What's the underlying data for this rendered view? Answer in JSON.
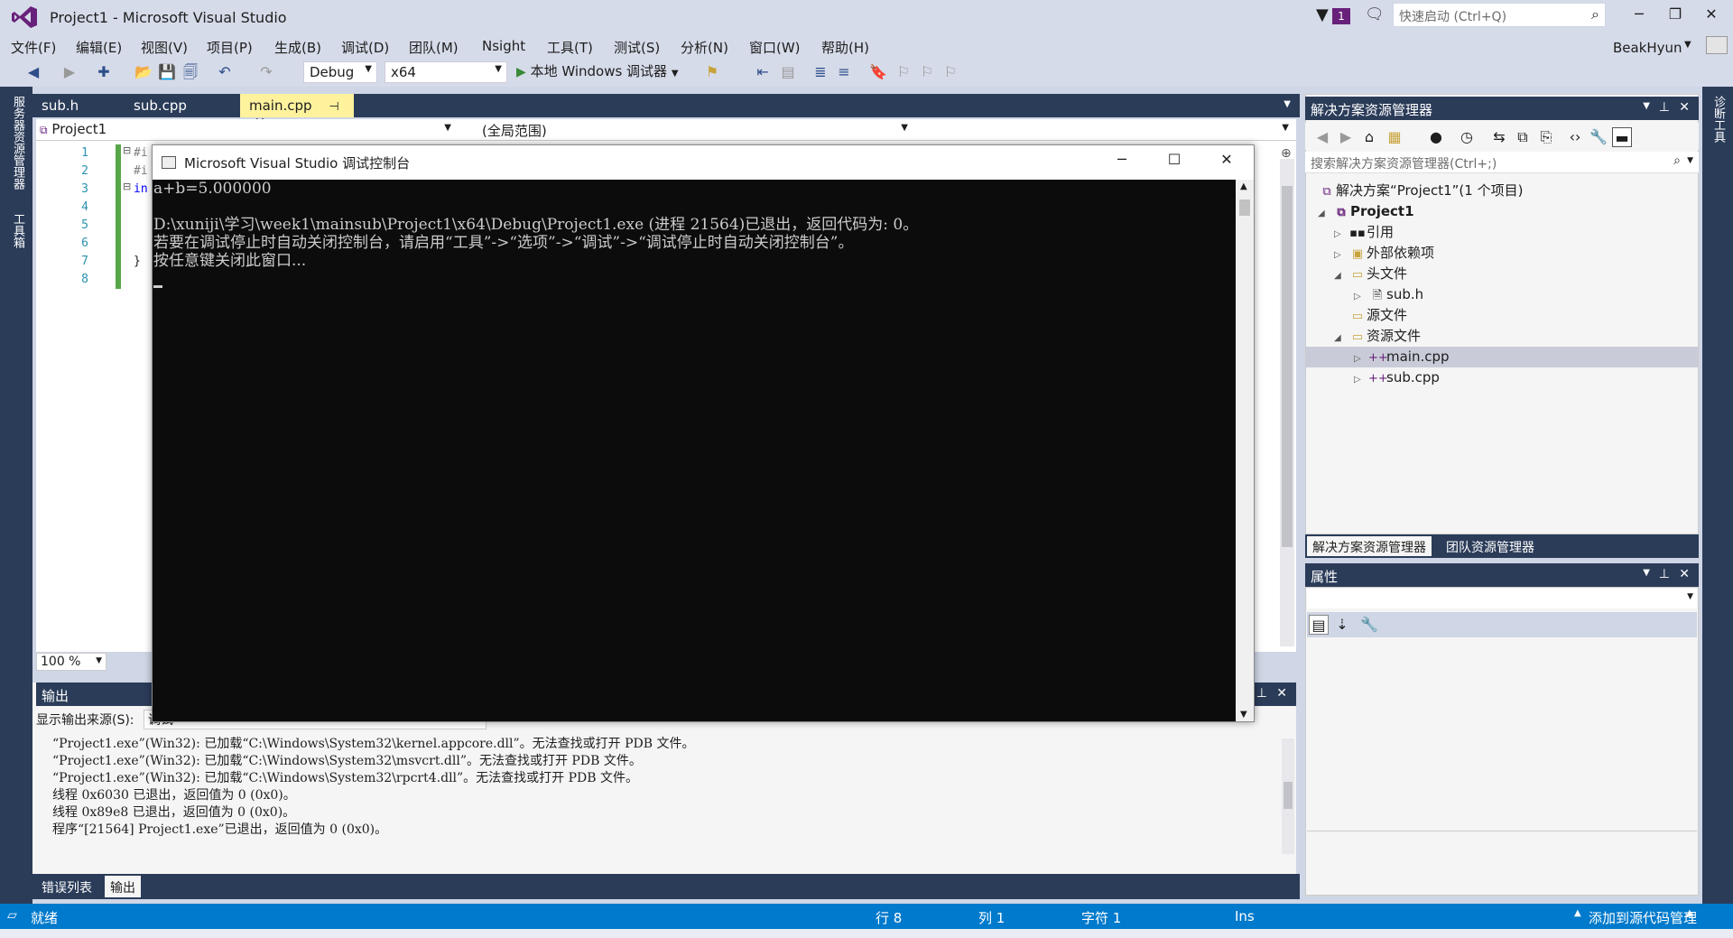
{
  "window": {
    "title": "Project1 - Microsoft Visual Studio",
    "notification_count": "1",
    "quick_launch_placeholder": "快速启动 (Ctrl+Q)",
    "user": "BeakHyun"
  },
  "menu": [
    "文件(F)",
    "编辑(E)",
    "视图(V)",
    "项目(P)",
    "生成(B)",
    "调试(D)",
    "团队(M)",
    "Nsight",
    "工具(T)",
    "测试(S)",
    "分析(N)",
    "窗口(W)",
    "帮助(H)"
  ],
  "toolbar": {
    "config": "Debug",
    "platform": "x64",
    "run_label": "本地 Windows 调试器"
  },
  "left_tabs": [
    "服务器资源管理器",
    "工具箱"
  ],
  "right_tabs": [
    "诊断工具"
  ],
  "editor": {
    "tabs": [
      {
        "label": "sub.h"
      },
      {
        "label": "sub.cpp"
      },
      {
        "label": "main.cpp",
        "active": true
      }
    ],
    "nav_project": "Project1",
    "nav_scope": "(全局范围)",
    "line_numbers": [
      "1",
      "2",
      "3",
      "4",
      "5",
      "6",
      "7",
      "8"
    ],
    "code_fragments": [
      "#i",
      "#i",
      "in",
      "",
      "",
      "",
      "}",
      ""
    ],
    "zoom": "100 %"
  },
  "console": {
    "title": "Microsoft Visual Studio 调试控制台",
    "lines": [
      "a+b=5.000000",
      "",
      "D:\\xuniji\\学习\\week1\\mainsub\\Project1\\x64\\Debug\\Project1.exe (进程 21564)已退出，返回代码为: 0。",
      "若要在调试停止时自动关闭控制台，请启用“工具”->“选项”->“调试”->“调试停止时自动关闭控制台”。",
      "按任意键关闭此窗口..."
    ]
  },
  "output": {
    "title": "输出",
    "source_label": "显示输出来源(S):",
    "source_value": "调试",
    "lines": [
      "“Project1.exe”(Win32): 已加载“C:\\Windows\\System32\\kernel.appcore.dll”。无法查找或打开 PDB 文件。",
      "“Project1.exe”(Win32): 已加载“C:\\Windows\\System32\\msvcrt.dll”。无法查找或打开 PDB 文件。",
      "“Project1.exe”(Win32): 已加载“C:\\Windows\\System32\\rpcrt4.dll”。无法查找或打开 PDB 文件。",
      "线程 0x6030 已退出，返回值为 0 (0x0)。",
      "线程 0x89e8 已退出，返回值为 0 (0x0)。",
      "程序“[21564] Project1.exe”已退出，返回值为 0 (0x0)。"
    ],
    "tabs": [
      {
        "label": "错误列表"
      },
      {
        "label": "输出",
        "active": true
      }
    ]
  },
  "solution_explorer": {
    "title": "解决方案资源管理器",
    "search_placeholder": "搜索解决方案资源管理器(Ctrl+;)",
    "solution": "解决方案“Project1”(1 个项目)",
    "project": "Project1",
    "nodes": {
      "references": "引用",
      "external": "外部依赖项",
      "headers": "头文件",
      "header_file": "sub.h",
      "sources": "源文件",
      "resources": "资源文件",
      "main": "main.cpp",
      "sub": "sub.cpp"
    },
    "tabs": [
      {
        "label": "解决方案资源管理器",
        "active": true
      },
      {
        "label": "团队资源管理器"
      }
    ]
  },
  "properties": {
    "title": "属性"
  },
  "status": {
    "ready": "就绪",
    "line": "行 8",
    "col": "列 1",
    "char": "字符 1",
    "ins": "Ins",
    "source_control": "添加到源代码管理"
  },
  "colors": {
    "accent": "#007acc",
    "panel_header": "#2b3c59",
    "active_tab": "#fff29d",
    "chrome": "#d6dbe9"
  }
}
